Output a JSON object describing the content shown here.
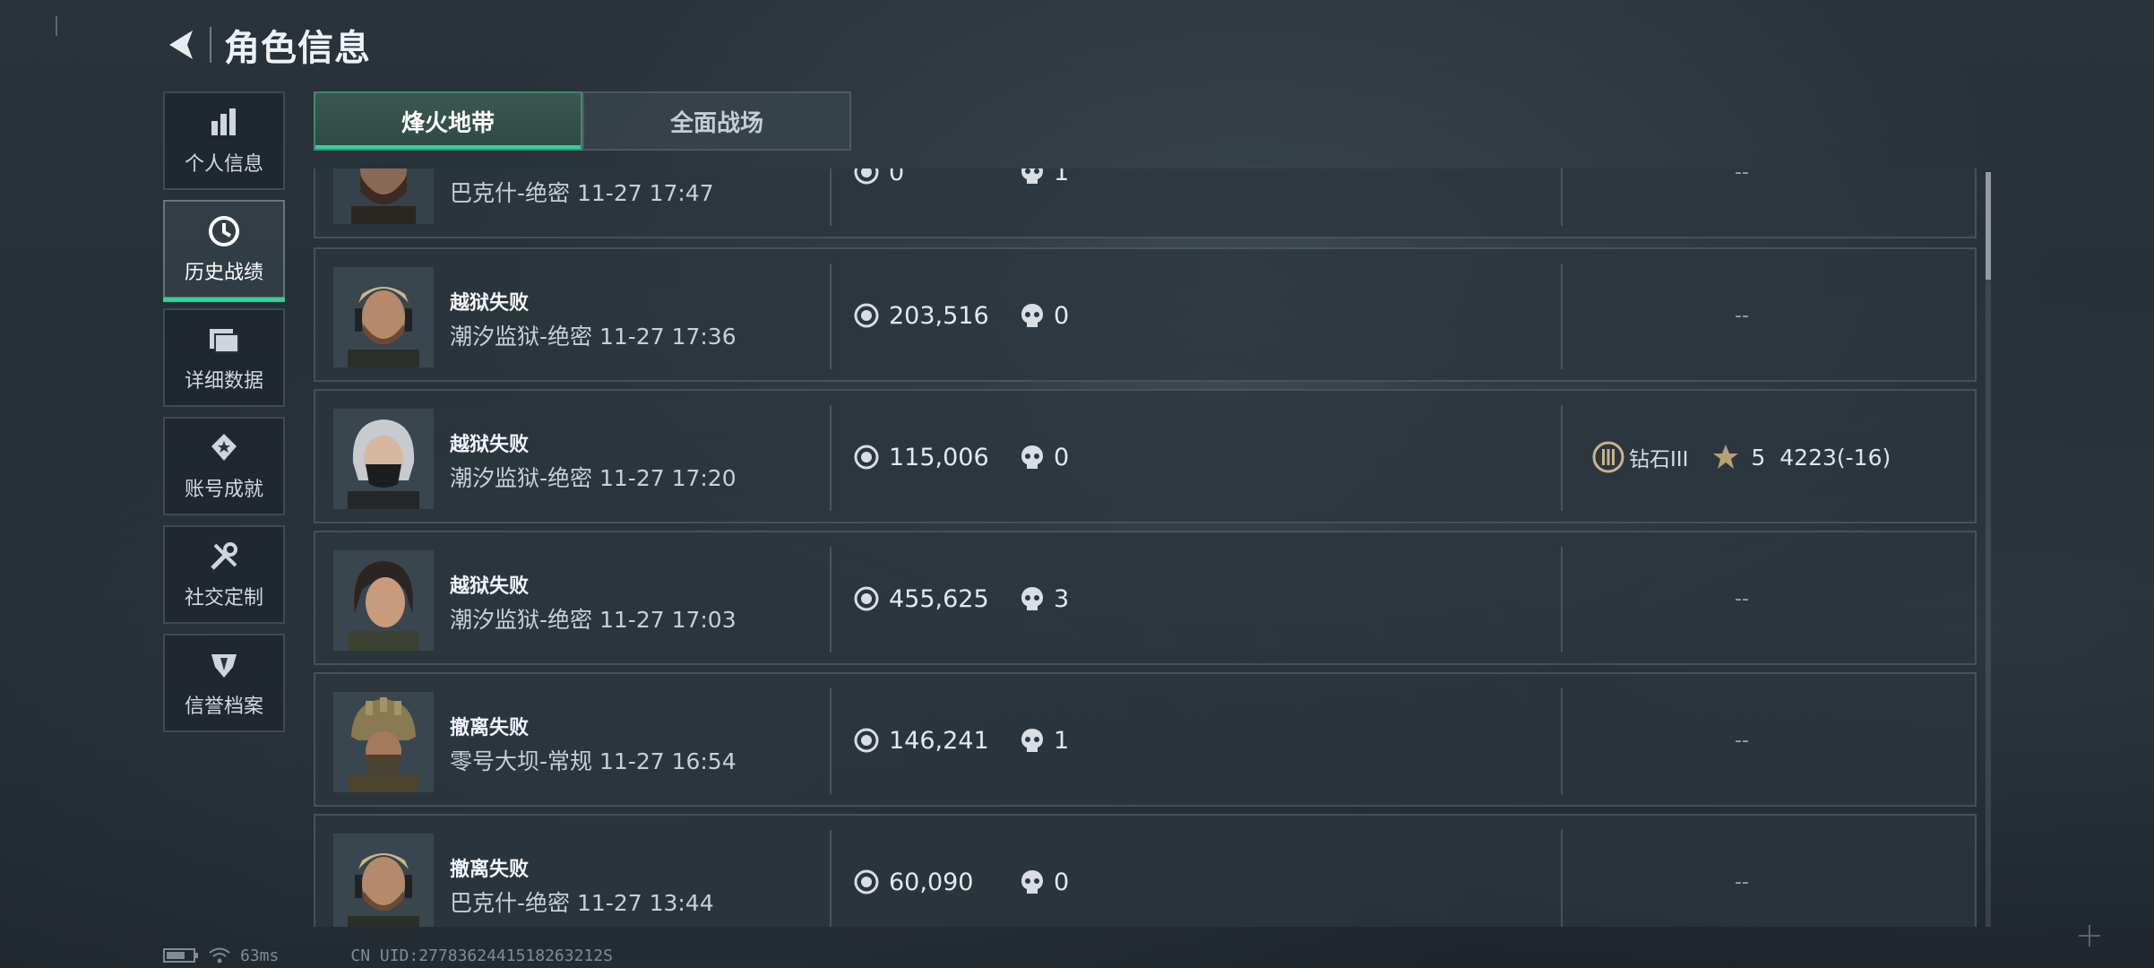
{
  "header": {
    "title": "角色信息"
  },
  "sidebar": {
    "items": [
      {
        "label": "个人信息",
        "icon": "bar-chart-icon",
        "active": false
      },
      {
        "label": "历史战绩",
        "icon": "clock-icon",
        "active": true
      },
      {
        "label": "详细数据",
        "icon": "folder-icon",
        "active": false
      },
      {
        "label": "账号成就",
        "icon": "medal-icon",
        "active": false
      },
      {
        "label": "社交定制",
        "icon": "tools-icon",
        "active": false
      },
      {
        "label": "信誉档案",
        "icon": "shield-icon",
        "active": false
      }
    ]
  },
  "tabs": [
    {
      "label": "烽火地带",
      "active": true
    },
    {
      "label": "全面战场",
      "active": false
    }
  ],
  "matches": [
    {
      "result": "",
      "map": "巴克什-绝密",
      "time": "11-27 17:47",
      "money": "0",
      "kills": "1",
      "rank": "--",
      "avatar": "bearded-operator"
    },
    {
      "result": "越狱失败",
      "map": "潮汐监狱-绝密",
      "time": "11-27 17:36",
      "money": "203,516",
      "kills": "0",
      "rank": "--",
      "avatar": "headset-operator"
    },
    {
      "result": "越狱失败",
      "map": "潮汐监狱-绝密",
      "time": "11-27 17:20",
      "money": "115,006",
      "kills": "0",
      "rank_badge": "钻石III",
      "stars": "5",
      "score": "4223(-16)",
      "avatar": "masked-operator"
    },
    {
      "result": "越狱失败",
      "map": "潮汐监狱-绝密",
      "time": "11-27 17:03",
      "money": "455,625",
      "kills": "3",
      "rank": "--",
      "avatar": "female-operator"
    },
    {
      "result": "撤离失败",
      "map": "零号大坝-常规",
      "time": "11-27 16:54",
      "money": "146,241",
      "kills": "1",
      "rank": "--",
      "avatar": "helmet-operator"
    },
    {
      "result": "撤离失败",
      "map": "巴克什-绝密",
      "time": "11-27 13:44",
      "money": "60,090",
      "kills": "0",
      "rank": "--",
      "avatar": "headset-operator"
    }
  ],
  "status": {
    "ping": "63ms",
    "uid": "CN UID:2778362441518263212S"
  },
  "colors": {
    "accent": "#2fd39a",
    "row_bg": "#2c363d",
    "tab_active": "#2f4a44"
  }
}
